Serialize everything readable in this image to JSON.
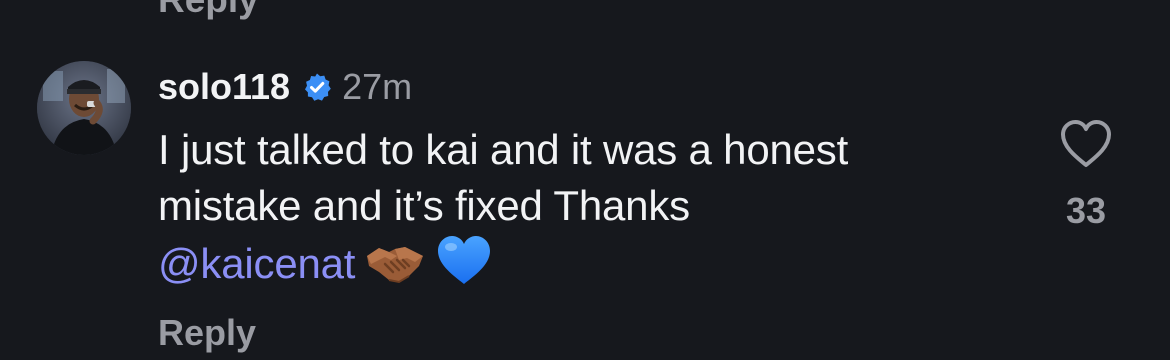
{
  "previous_comment": {
    "reply_label": "Reply"
  },
  "comment": {
    "username": "solo118",
    "verified": true,
    "time_ago": "27m",
    "text_line1": "I just talked to kai and it was a honest",
    "text_line2": "mistake and it’s fixed Thanks",
    "mention": "@kaicenat",
    "emojis": [
      "handshake-emoji",
      "blue-heart-emoji"
    ],
    "like_count": "33",
    "reply_label": "Reply",
    "icons": {
      "like": "heart-outline-icon",
      "verified": "verified-badge-icon"
    }
  },
  "colors": {
    "background": "#16181d",
    "text": "#f2f3f5",
    "muted": "#9a9ca3",
    "mention": "#8b8ff5",
    "verified": "#3c8ff5"
  }
}
